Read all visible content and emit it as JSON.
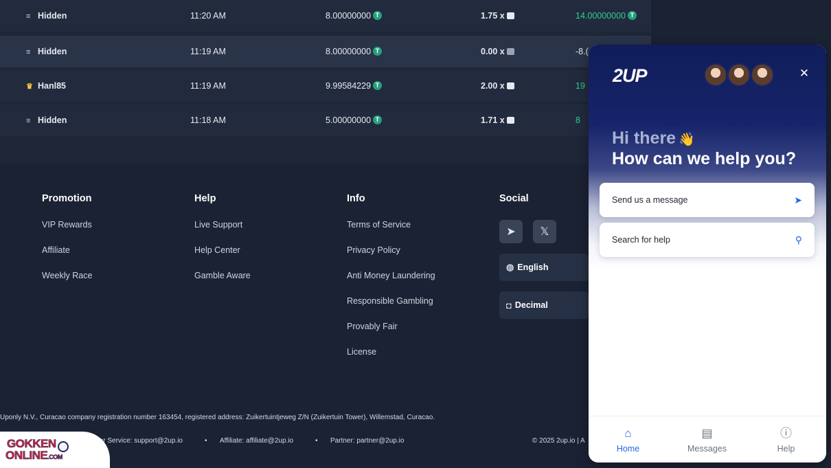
{
  "bets": [
    {
      "user": "Hidden",
      "user_icon": "hidden-user-icon",
      "time": "11:20 AM",
      "bet": "8.00000000",
      "multiplier": "1.75 x",
      "payout": "14.00000000",
      "payout_positive": true
    },
    {
      "user": "Hidden",
      "user_icon": "hidden-user-icon",
      "time": "11:19 AM",
      "bet": "8.00000000",
      "multiplier": "0.00 x",
      "payout": "-8.(",
      "payout_positive": false
    },
    {
      "user": "Hanl85",
      "user_icon": "crown-icon",
      "time": "11:19 AM",
      "bet": "9.99584229",
      "multiplier": "2.00 x",
      "payout": "19",
      "payout_positive": true
    },
    {
      "user": "Hidden",
      "user_icon": "hidden-user-icon",
      "time": "11:18 AM",
      "bet": "5.00000000",
      "multiplier": "1.71 x",
      "payout": "8",
      "payout_positive": true
    }
  ],
  "footer": {
    "promotion": {
      "title": "Promotion",
      "links": [
        "VIP Rewards",
        "Affiliate",
        "Weekly Race"
      ]
    },
    "help": {
      "title": "Help",
      "links": [
        "Live Support",
        "Help Center",
        "Gamble Aware"
      ]
    },
    "info": {
      "title": "Info",
      "links": [
        "Terms of Service",
        "Privacy Policy",
        "Anti Money Laundering",
        "Responsible Gambling",
        "Provably Fair",
        "License"
      ]
    },
    "social": {
      "title": "Social",
      "language": "English",
      "odds_format": "Decimal"
    },
    "legal": "Uponly N.V., Curacao company registration number 163454, registered address: Zuikertuintjeweg Z/N (Zuikertuin Tower), Willemstad, Curacao.",
    "customer_service": "tomer Service: support@2up.io",
    "affiliate_contact": "Affiliate: affiliate@2up.io",
    "partner_contact": "Partner: partner@2up.io",
    "copyright": "© 2025 2up.io | A",
    "separator": "•"
  },
  "watermark": {
    "line1": "GOKKEN",
    "line2": "ONLINE",
    "suffix": ".COM"
  },
  "chat": {
    "brand": "2UP",
    "greeting": "Hi there",
    "greeting_emoji": "👋",
    "headline": "How can we help you?",
    "send_message": "Send us a message",
    "search_help": "Search for help",
    "nav": {
      "home": "Home",
      "messages": "Messages",
      "help": "Help"
    }
  },
  "colors": {
    "accent": "#2563eb",
    "positive": "#2fd08b",
    "usdt": "#26a17b",
    "chat_header": "#16246a"
  }
}
